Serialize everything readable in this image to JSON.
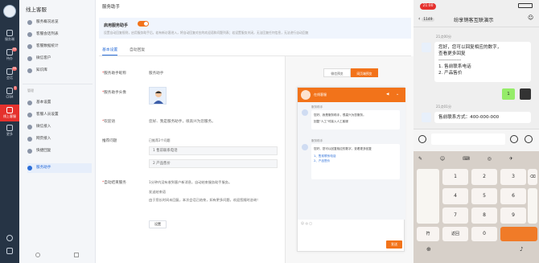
{
  "nav": {
    "items": [
      {
        "label": "服务端",
        "badge": ""
      },
      {
        "label": "待办",
        "badge": "99"
      },
      {
        "label": "会话",
        "badge": "99"
      },
      {
        "label": "CRM",
        "badge": "1"
      },
      {
        "label": "线上客服",
        "badge": ""
      },
      {
        "label": "更多",
        "badge": ""
      }
    ]
  },
  "sidebar": {
    "title": "线上客服",
    "items": [
      {
        "label": "服务概况总览"
      },
      {
        "label": "客服会话列表"
      },
      {
        "label": "客服数据统计"
      },
      {
        "label": "微信客户"
      },
      {
        "label": "知识库"
      }
    ],
    "group_label": "管理",
    "manage_items": [
      {
        "label": "基本设置"
      },
      {
        "label": "客服人员设置"
      },
      {
        "label": "微信接入"
      },
      {
        "label": "网页接入"
      },
      {
        "label": "快捷回复"
      },
      {
        "label": "服务助手"
      }
    ]
  },
  "main": {
    "title": "服务助手",
    "toggle_label": "启用服务助手",
    "toggle_desc": "设置自动回复规则，启用服务助手后，若有新访客进入，将自动回复对应的欢迎语和问题列表；若设置服务关闭，无法回复任何信息，无法进行自动回复",
    "tabs": [
      "基本设置",
      "自动回复"
    ],
    "fields": {
      "name_label": "服务助手昵称",
      "name_value": "服务助手",
      "avatar_label": "服务助手头像",
      "welcome_label": "欢迎语",
      "welcome_value": "您好、我是服务助手，很高兴为您服务。",
      "questions_label": "推荐问题",
      "questions_count": "已推荐2个问题",
      "questions": [
        "1 售前联系电话",
        "2 产品售价"
      ],
      "end_label": "自动结束服务",
      "end_text1": "1分钟内没有收到客户新消息，自动结束服务助手服务。",
      "end_text2": "发送结束语",
      "end_text3": "由于您长时间未回复，本次会话已结束，如有更多问题，欢迎您随时咨询！",
      "settings_btn": "设置"
    }
  },
  "preview": {
    "btn_wechat": "微信预览",
    "btn_web": "网页端预览",
    "window_title": "在线客服",
    "msg1_name": "服务助手",
    "msg1_line1": "您好、我是服务助手，很高兴为您服务。",
    "msg1_line2": "回复\"人工\"可接入人工客服",
    "msg2_name": "服务助手",
    "msg2_line1": "您好，您可以回复相应的数字，查看更多回复",
    "msg2_opt1": "1、售前联系电话",
    "msg2_opt2": "2、产品售价",
    "send_btn": "发送"
  },
  "phone": {
    "time": "21:00",
    "back_count": "1149",
    "chat_title": "纷享销客互联演示",
    "ts1": "21点00分",
    "msg1_l1": "您好，您可以回复相应的数字，",
    "msg1_l2": "查看更多回复",
    "msg1_sep": "--------------",
    "msg1_o1": "1. 售前联系电话",
    "msg1_o2": "2. 产品售价",
    "reply": "1",
    "ts2": "21点01分",
    "msg2": "售前联系方式：400-000-000",
    "keys": {
      "row1": [
        "1",
        "2",
        "3"
      ],
      "row2": [
        "4",
        "5",
        "6"
      ],
      "row3": [
        "7",
        "8",
        "9"
      ],
      "zero": "0",
      "ret": "返回",
      "sym": "符"
    }
  },
  "colors": {
    "accent": "#f2731a",
    "nav_bg": "#263445",
    "active_nav": "#e5312d",
    "link_blue": "#2b6ed8"
  }
}
